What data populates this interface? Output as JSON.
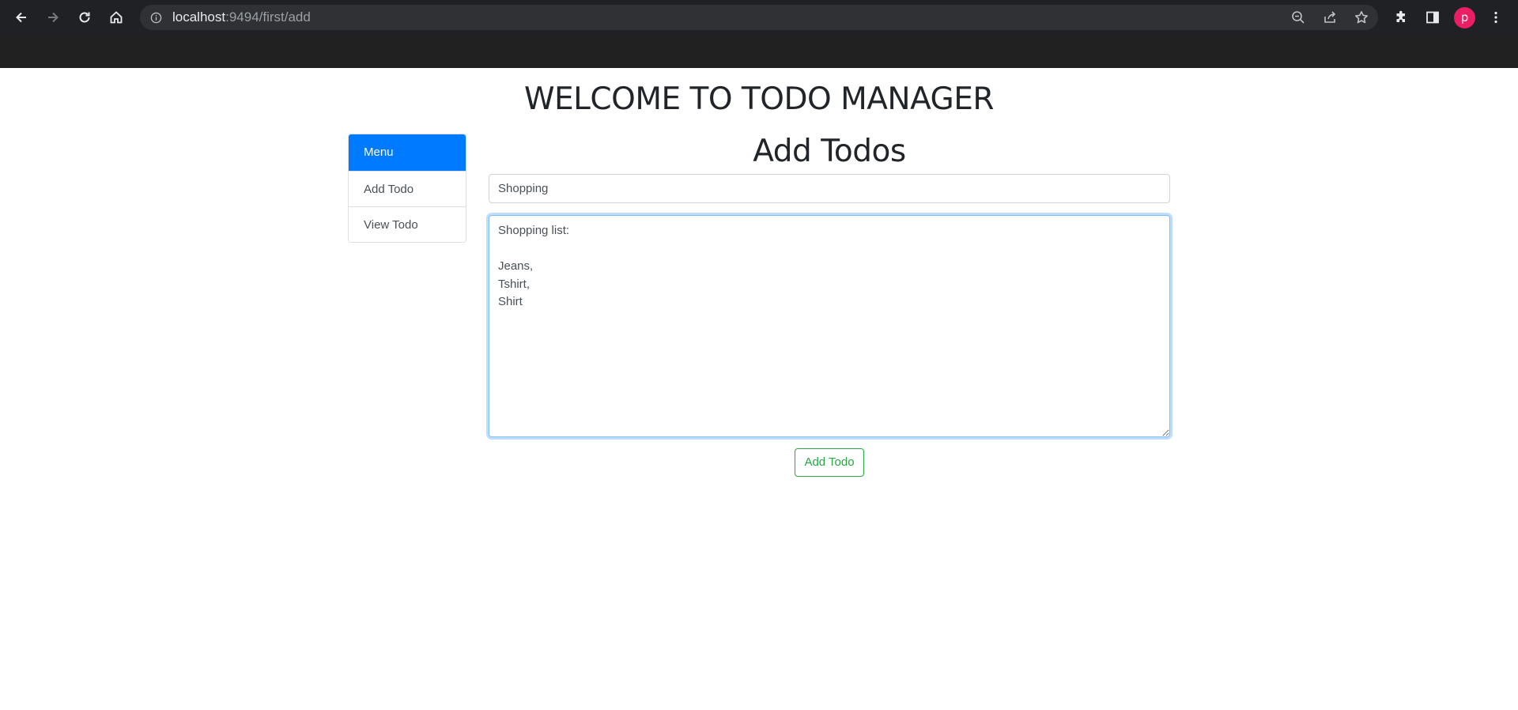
{
  "browser": {
    "url_host": "localhost",
    "url_rest": ":9494/first/add",
    "profile_initial": "p",
    "icons": [
      "back-arrow-icon",
      "forward-arrow-icon",
      "reload-icon",
      "home-icon",
      "info-icon",
      "zoom-out-icon",
      "share-icon",
      "star-icon",
      "extensions-icon",
      "side-panel-icon",
      "more-vertical-icon"
    ]
  },
  "page": {
    "title": "WELCOME TO TODO MANAGER"
  },
  "menu": {
    "header": "Menu",
    "items": [
      {
        "label": "Add Todo"
      },
      {
        "label": "View Todo"
      }
    ],
    "active_color": "#007bff"
  },
  "form": {
    "heading": "Add Todos",
    "title_value": "Shopping",
    "content_value": "Shopping list:\n\nJeans,\nTshirt,\nShirt",
    "submit_label": "Add Todo",
    "submit_color": "#28a745"
  }
}
